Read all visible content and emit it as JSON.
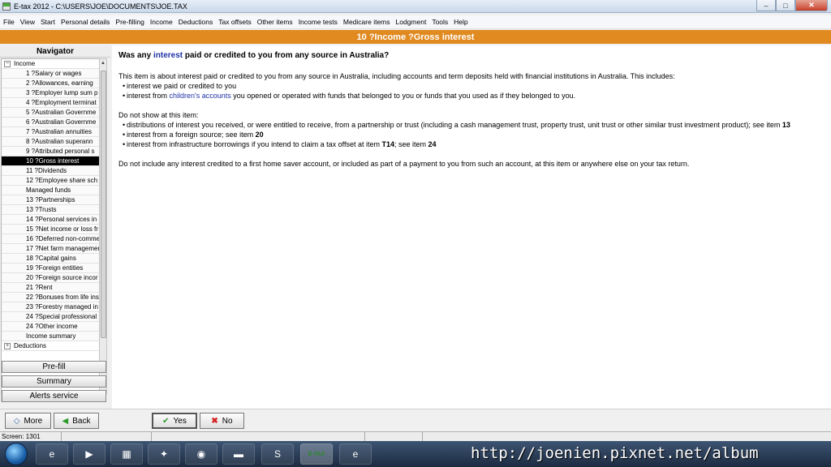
{
  "window": {
    "title": "E-tax 2012 - C:\\USERS\\JOE\\DOCUMENTS\\JOE.TAX",
    "controls": {
      "minimize": "–",
      "maximize": "□",
      "close": "✕"
    }
  },
  "menu": [
    {
      "label": "File"
    },
    {
      "label": "View"
    },
    {
      "label": "Start"
    },
    {
      "label": "Personal details"
    },
    {
      "label": "Pre-filling"
    },
    {
      "label": "Income"
    },
    {
      "label": "Deductions"
    },
    {
      "label": "Tax offsets"
    },
    {
      "label": "Other items"
    },
    {
      "label": "Income tests"
    },
    {
      "label": "Medicare items"
    },
    {
      "label": "Lodgment"
    },
    {
      "label": "Tools"
    },
    {
      "label": "Help"
    }
  ],
  "page_heading": "10 ?Income ?Gross interest",
  "navigator": {
    "title": "Navigator",
    "section_income": "Income",
    "section_deductions": "Deductions",
    "items": [
      "1 ?Salary or wages",
      "2 ?Allowances, earning",
      "3 ?Employer lump sum p",
      "4 ?Employment terminat",
      "5 ?Australian Governme",
      "6 ?Australian Governme",
      "7 ?Australian annuities",
      "8 ?Australian superann",
      "9 ?Attributed personal s",
      "10 ?Gross interest",
      "11 ?Dividends",
      "12 ?Employee share sch",
      "Managed funds",
      "13 ?Partnerships",
      "13 ?Trusts",
      "14 ?Personal services in",
      "15 ?Net income or loss fr",
      "16 ?Deferred non-comme",
      "17 ?Net farm managemer",
      "18 ?Capital gains",
      "19 ?Foreign entities",
      "20 ?Foreign source incor",
      "21 ?Rent",
      "22 ?Bonuses from life ins",
      "23 ?Forestry managed in",
      "24 ?Special professional",
      "24 ?Other income",
      "Income summary"
    ],
    "selected_index": 9,
    "buttons": {
      "prefill": "Pre-fill",
      "summary": "Summary",
      "alerts": "Alerts service"
    }
  },
  "content": {
    "question_pre": "Was any ",
    "question_link": "interest",
    "question_post": " paid or credited to you from any source in Australia?",
    "intro": "This item is about interest paid or credited to you from any source in Australia, including accounts and term deposits held with financial institutions in Australia. This includes:",
    "include_1": "interest we paid or credited to you",
    "include_2_pre": "interest from ",
    "include_2_link": "children's accounts",
    "include_2_post": " you opened or operated with funds that belonged to you or funds that you used as if they belonged to you.",
    "exclude_heading": "Do not show at this item:",
    "exclude_1_text": "distributions of interest you received, or were entitled to receive, from a partnership or trust (including a cash management trust, property trust, unit trust or other similar trust investment product); see item ",
    "exclude_1_ref": "13",
    "exclude_2_text": "interest from a foreign source; see item ",
    "exclude_2_ref": "20",
    "exclude_3_text": "interest from infrastructure borrowings if you intend to claim a tax offset at item ",
    "exclude_3_ref1": "T14",
    "exclude_3_mid": "; see item ",
    "exclude_3_ref2": "24",
    "closing": "Do not include any interest credited to a first home saver account, or included as part of a payment to you from such an account, at this item or anywhere else on your tax return."
  },
  "actions": {
    "more": "More",
    "back": "Back",
    "yes": "Yes",
    "no": "No"
  },
  "status": {
    "screen": "Screen: 1301"
  },
  "taskbar": {
    "icons": [
      "ie-icon",
      "media-icon",
      "explorer-icon",
      "app-icon",
      "chrome-icon",
      "folder-icon",
      "skype-icon",
      "etax-icon",
      "ie2-icon"
    ],
    "etax_label": "E-TAX"
  },
  "watermark": "http://joenien.pixnet.net/album"
}
